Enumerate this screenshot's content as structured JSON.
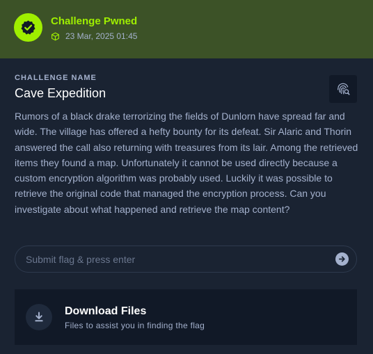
{
  "banner": {
    "title": "Challenge Pwned",
    "date": "23 Mar, 2025 01:45",
    "badge_icon": "verified-check-icon",
    "date_icon": "cube-icon",
    "accent": "#9fef00",
    "background": "#3c5227"
  },
  "challenge": {
    "section_label": "CHALLENGE NAME",
    "name": "Cave Expedition",
    "description": "Rumors of a black drake terrorizing the fields of Dunlorn have spread far and wide. The village has offered a hefty bounty for its defeat. Sir Alaric and Thorin answered the call also returning with treasures from its lair. Among the retrieved items they found a map. Unfortunately it cannot be used directly because a custom encryption algorithm was probably used. Luckily it was possible to retrieve the original code that managed the encryption process. Can you investigate about what happened and retrieve the map content?",
    "action_icon": "fingerprint-search-icon"
  },
  "flag": {
    "placeholder": "Submit flag & press enter",
    "value": "",
    "submit_icon": "arrow-right-circle-icon"
  },
  "download": {
    "title": "Download Files",
    "subtitle": "Files to assist you in finding the flag",
    "icon": "download-icon"
  },
  "colors": {
    "page_bg": "#1a2332",
    "card_bg": "#111927",
    "text_muted": "#a4b1cd",
    "text_white": "#ffffff"
  }
}
